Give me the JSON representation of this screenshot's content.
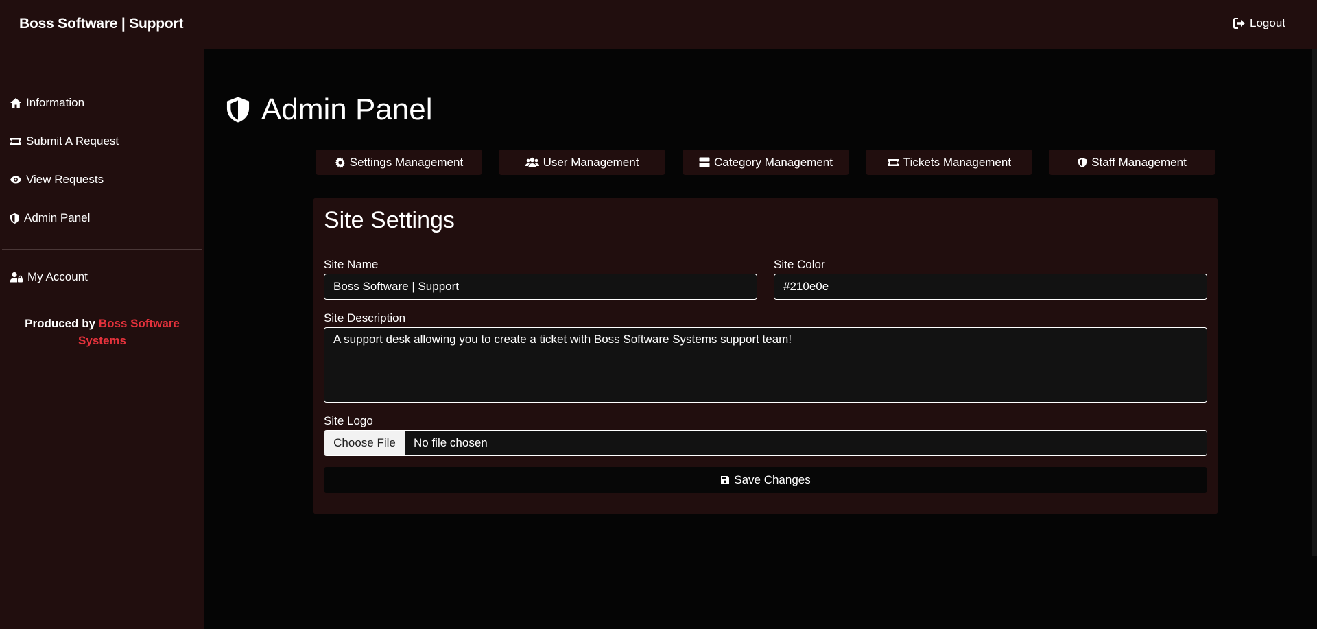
{
  "brand": "Boss Software | Support",
  "topbar": {
    "logout_label": "Logout"
  },
  "sidebar": {
    "items": [
      {
        "label": "Information",
        "icon": "home-icon"
      },
      {
        "label": "Submit A Request",
        "icon": "ticket-icon"
      },
      {
        "label": "View Requests",
        "icon": "eye-icon"
      },
      {
        "label": "Admin Panel",
        "icon": "shield-icon"
      },
      {
        "label": "My Account",
        "icon": "user-lock-icon"
      }
    ],
    "produced_prefix": "Produced by ",
    "produced_link": "Boss Software Systems"
  },
  "page": {
    "title": "Admin Panel",
    "icon": "shield-icon"
  },
  "tabs": [
    {
      "label": "Settings Management",
      "icon": "gear-icon"
    },
    {
      "label": "User Management",
      "icon": "users-icon"
    },
    {
      "label": "Category Management",
      "icon": "server-icon"
    },
    {
      "label": "Tickets Management",
      "icon": "ticket-icon"
    },
    {
      "label": "Staff Management",
      "icon": "shield-icon"
    }
  ],
  "form": {
    "title": "Site Settings",
    "site_name_label": "Site Name",
    "site_name_value": "Boss Software | Support",
    "site_color_label": "Site Color",
    "site_color_value": "#210e0e",
    "site_description_label": "Site Description",
    "site_description_value": "A support desk allowing you to create a ticket with Boss Software Systems support team!",
    "site_logo_label": "Site Logo",
    "file_button_label": "Choose File",
    "file_status": "No file chosen",
    "save_label": "Save Changes"
  },
  "colors": {
    "panel": "#210e0e",
    "background": "#050505",
    "accent_red": "#e5323c"
  }
}
